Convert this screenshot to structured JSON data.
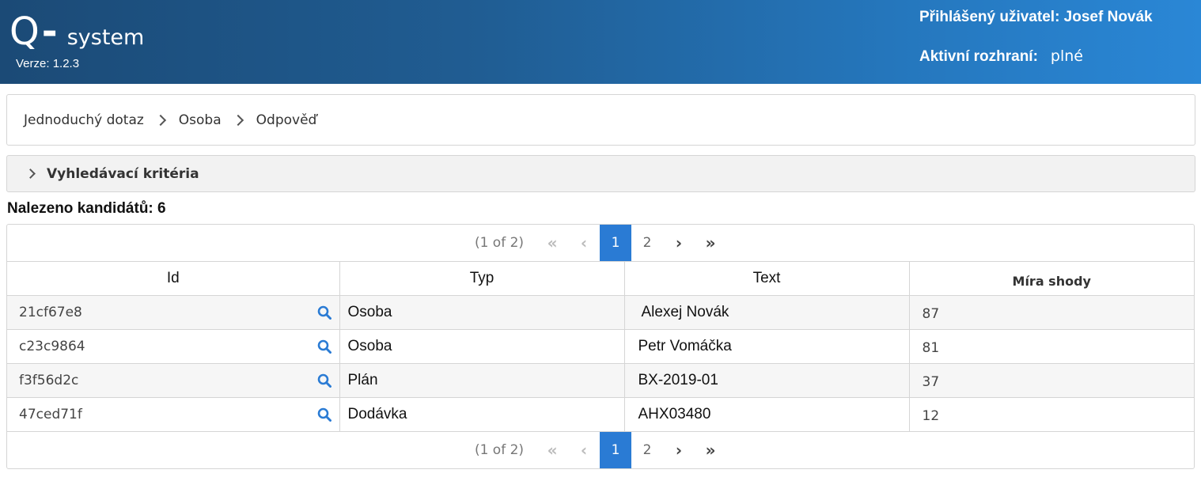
{
  "header": {
    "logo_q": "Q",
    "logo_dash": "-",
    "logo_system": "system",
    "version": "Verze: 1.2.3",
    "user_line": "Přihlášený uživatel: Josef Novák",
    "iface_label": "Aktivní rozhraní:",
    "iface_value": "plné"
  },
  "breadcrumb": [
    "Jednoduchý dotaz",
    "Osoba",
    "Odpověď"
  ],
  "criteria": {
    "label": "Vyhledávací kritéria"
  },
  "found": "Nalezeno kandidátů: 6",
  "paginator": {
    "report": "(1 of 2)",
    "pages": [
      "1",
      "2"
    ],
    "current": "1",
    "first_icon": "«",
    "prev_icon": "‹",
    "next_icon": "›",
    "last_icon": "»"
  },
  "table": {
    "columns": [
      "Id",
      "Typ",
      "Text",
      "Míra shody"
    ],
    "rows": [
      {
        "id": "21cf67e8",
        "typ": "Osoba",
        "text": "Alexej Novák",
        "score": "87"
      },
      {
        "id": "c23c9864",
        "typ": "Osoba",
        "text": "Petr Vomáčka",
        "score": "81"
      },
      {
        "id": "f3f56d2c",
        "typ": "Plán",
        "text": "BX-2019-01",
        "score": "37"
      },
      {
        "id": "47ced71f",
        "typ": "Dodávka",
        "text": "AHX03480",
        "score": "12"
      }
    ]
  },
  "icons": {
    "row_action": "search-icon",
    "crumb_separator": "chevron-right-icon",
    "criteria_toggle": "chevron-right-icon"
  },
  "colors": {
    "header_start": "#1b4a76",
    "header_end": "#2a87d6",
    "accent": "#2a7bd4"
  }
}
